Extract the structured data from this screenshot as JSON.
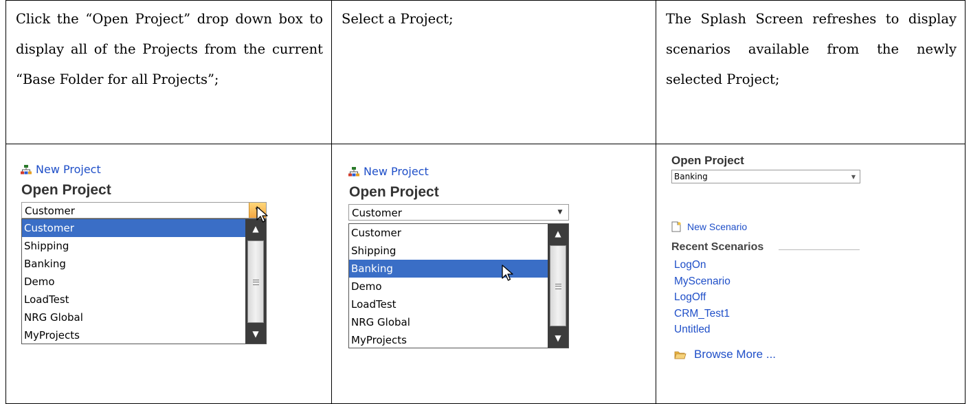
{
  "instructions": {
    "step1": "Click the “Open Project” drop down box to display all of the Projects from the current “Base Folder for all Projects”;",
    "step2": "Select a Project;",
    "step3": "The Splash Screen refreshes to display scenarios available from the newly selected Project;"
  },
  "panel1": {
    "new_project": "New Project",
    "open_project": "Open Project",
    "selected": "Customer",
    "items": [
      "Customer",
      "Shipping",
      "Banking",
      "Demo",
      "LoadTest",
      "NRG Global",
      "MyProjects"
    ],
    "highlighted": "Customer"
  },
  "panel2": {
    "new_project": "New Project",
    "open_project": "Open Project",
    "selected": "Customer",
    "items": [
      "Customer",
      "Shipping",
      "Banking",
      "Demo",
      "LoadTest",
      "NRG Global",
      "MyProjects"
    ],
    "highlighted": "Banking"
  },
  "panel3": {
    "open_project": "Open Project",
    "selected": "Banking",
    "new_scenario": "New Scenario",
    "recent_title": "Recent Scenarios",
    "recent": [
      "LogOn",
      "MyScenario",
      "LogOff",
      "CRM_Test1",
      "Untitled"
    ],
    "browse_more": "Browse More ..."
  },
  "colors": {
    "link": "#1f4fc8",
    "selection": "#3a6ec6",
    "scrollbar": "#3c3c3c",
    "hot_arrow": "#f4a742"
  }
}
